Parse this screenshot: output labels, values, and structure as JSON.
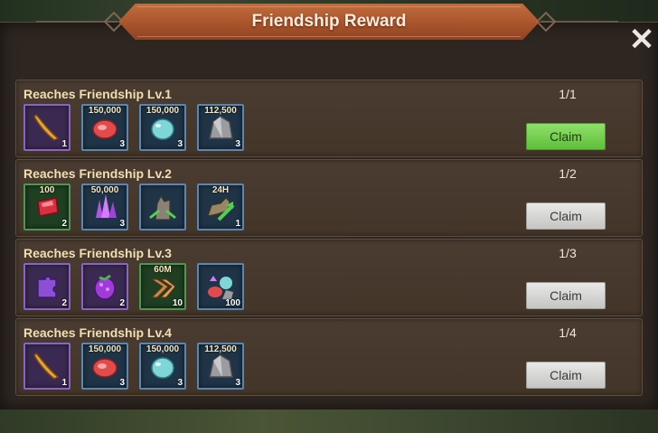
{
  "window": {
    "title": "Friendship Reward",
    "close_icon": "close-icon"
  },
  "rows": [
    {
      "title": "Reaches Friendship Lv.1",
      "progress": "1/1",
      "claim_label": "Claim",
      "claim_active": true,
      "items": [
        {
          "icon": "horn-icon",
          "label": "",
          "qty": "1"
        },
        {
          "icon": "meat-icon",
          "label": "150,000",
          "qty": "3"
        },
        {
          "icon": "water-drop-icon",
          "label": "150,000",
          "qty": "3"
        },
        {
          "icon": "stone-icon",
          "label": "112,500",
          "qty": "3"
        }
      ]
    },
    {
      "title": "Reaches Friendship Lv.2",
      "progress": "1/2",
      "claim_label": "Claim",
      "claim_active": false,
      "items": [
        {
          "icon": "ruby-icon",
          "label": "100",
          "qty": "2"
        },
        {
          "icon": "crystal-icon",
          "label": "50,000",
          "qty": "3"
        },
        {
          "icon": "wolf-boost-icon",
          "label": "",
          "qty": ""
        },
        {
          "icon": "wolf-speed-icon",
          "label": "24H",
          "qty": "1"
        }
      ]
    },
    {
      "title": "Reaches Friendship Lv.3",
      "progress": "1/3",
      "claim_label": "Claim",
      "claim_active": false,
      "items": [
        {
          "icon": "puzzle-piece-icon",
          "label": "",
          "qty": "2"
        },
        {
          "icon": "berry-icon",
          "label": "",
          "qty": "2"
        },
        {
          "icon": "speedup-icon",
          "label": "60M",
          "qty": "10"
        },
        {
          "icon": "resource-bundle-icon",
          "label": "",
          "qty": "100"
        }
      ]
    },
    {
      "title": "Reaches Friendship Lv.4",
      "progress": "1/4",
      "claim_label": "Claim",
      "claim_active": false,
      "items": [
        {
          "icon": "horn-icon",
          "label": "",
          "qty": "1"
        },
        {
          "icon": "meat-icon",
          "label": "150,000",
          "qty": "3"
        },
        {
          "icon": "water-drop-icon",
          "label": "150,000",
          "qty": "3"
        },
        {
          "icon": "stone-icon",
          "label": "112,500",
          "qty": "3"
        }
      ]
    }
  ]
}
